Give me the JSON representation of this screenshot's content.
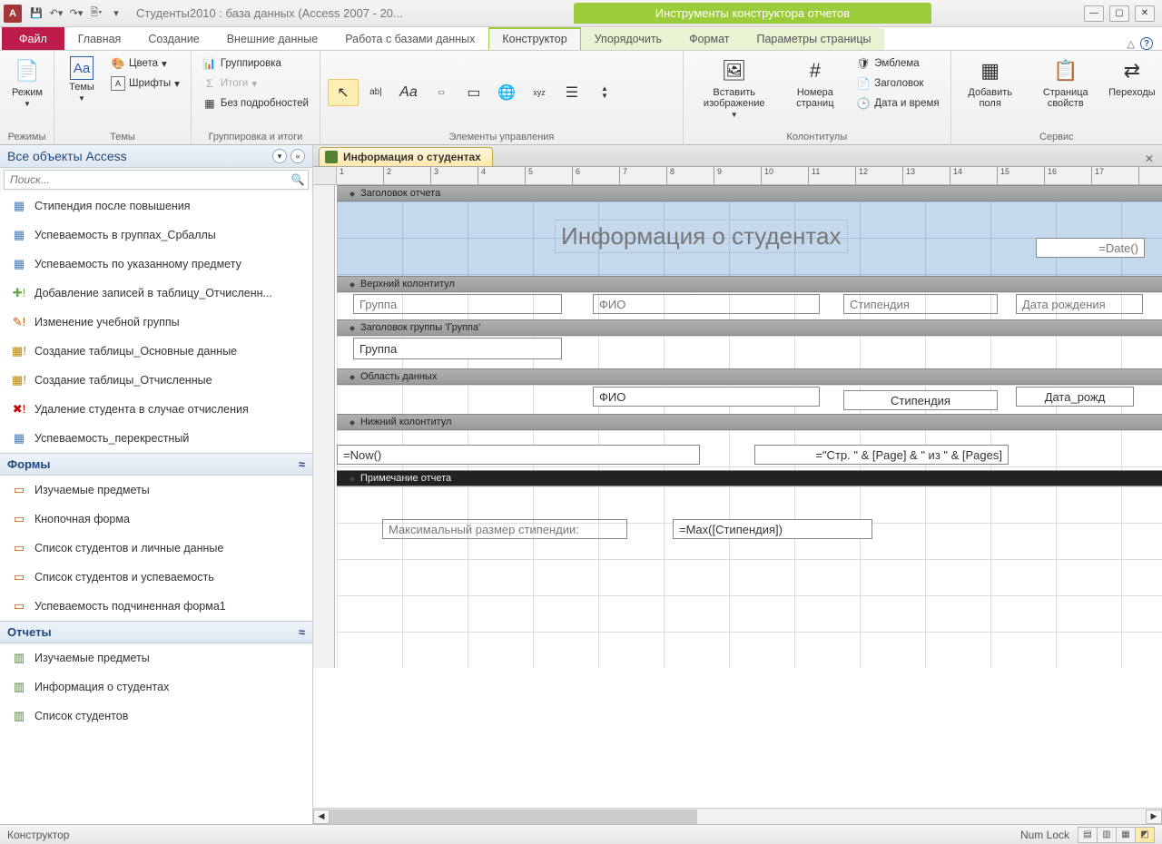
{
  "title": {
    "app_icon": "A",
    "doc": "Студенты2010 : база данных (Access 2007 - 20...",
    "context": "Инструменты конструктора отчетов"
  },
  "tabs": {
    "file": "Файл",
    "items": [
      "Главная",
      "Создание",
      "Внешние данные",
      "Работа с базами данных"
    ],
    "ctx": [
      "Конструктор",
      "Упорядочить",
      "Формат",
      "Параметры страницы"
    ],
    "active": "Конструктор"
  },
  "ribbon": {
    "g_modes": {
      "mode": "Режим",
      "themes": "Темы",
      "colors": "Цвета",
      "fonts": "Шрифты",
      "label_modes": "Режимы",
      "label_themes": "Темы"
    },
    "g_group": {
      "grouping": "Группировка",
      "totals": "Итоги",
      "details": "Без подробностей",
      "label": "Группировка и итоги"
    },
    "g_controls": {
      "label": "Элементы управления"
    },
    "g_insert": {
      "img": "Вставить изображение",
      "pagenum": "Номера страниц",
      "logo": "Эмблема",
      "title": "Заголовок",
      "datetime": "Дата и время",
      "label": "Колонтитулы"
    },
    "g_tools": {
      "addfields": "Добавить поля",
      "propsheet": "Страница свойств",
      "taborder": "Переходы",
      "label": "Сервис"
    }
  },
  "nav": {
    "header": "Все объекты Access",
    "search_placeholder": "Поиск...",
    "queries": [
      "Стипендия после повышения",
      "Успеваемость в группах_Србаллы",
      "Успеваемость по указанному предмету",
      "Добавление записей в таблицу_Отчисленн...",
      "Изменение учебной группы",
      "Создание таблицы_Основные данные",
      "Создание таблицы_Отчисленные",
      "Удаление студента в случае отчисления",
      "Успеваемость_перекрестный"
    ],
    "cat_forms": "Формы",
    "forms": [
      "Изучаемые предметы",
      "Кнопочная форма",
      "Список студентов и личные данные",
      "Список студентов и успеваемость",
      "Успеваемость подчиненная форма1"
    ],
    "cat_reports": "Отчеты",
    "reports": [
      "Изучаемые предметы",
      "Информация о студентах",
      "Список студентов"
    ]
  },
  "doc": {
    "tab": "Информация о студентах"
  },
  "sections": {
    "reportheader": "Заголовок отчета",
    "pageheader": "Верхний колонтитул",
    "groupheader": "Заголовок группы 'Группа'",
    "detail": "Область данных",
    "pagefooter": "Нижний колонтитул",
    "reportfooter": "Примечание отчета"
  },
  "controls": {
    "title": "Информация о студентах",
    "date": "=Date()",
    "col_group": "Группа",
    "col_fio": "ФИО",
    "col_stip": "Стипендия",
    "col_dob": "Дата рождения",
    "gh_group": "Группа",
    "d_fio": "ФИО",
    "d_stip": "Стипендия",
    "d_dob": "Дата_рожд",
    "now": "=Now()",
    "pages": "=\"Стр. \" & [Page] & \" из \" & [Pages]",
    "max_lbl": "Максимальный размер стипендии:",
    "max_expr": "=Max([Стипендия])"
  },
  "status": {
    "mode": "Конструктор",
    "numlock": "Num Lock"
  }
}
